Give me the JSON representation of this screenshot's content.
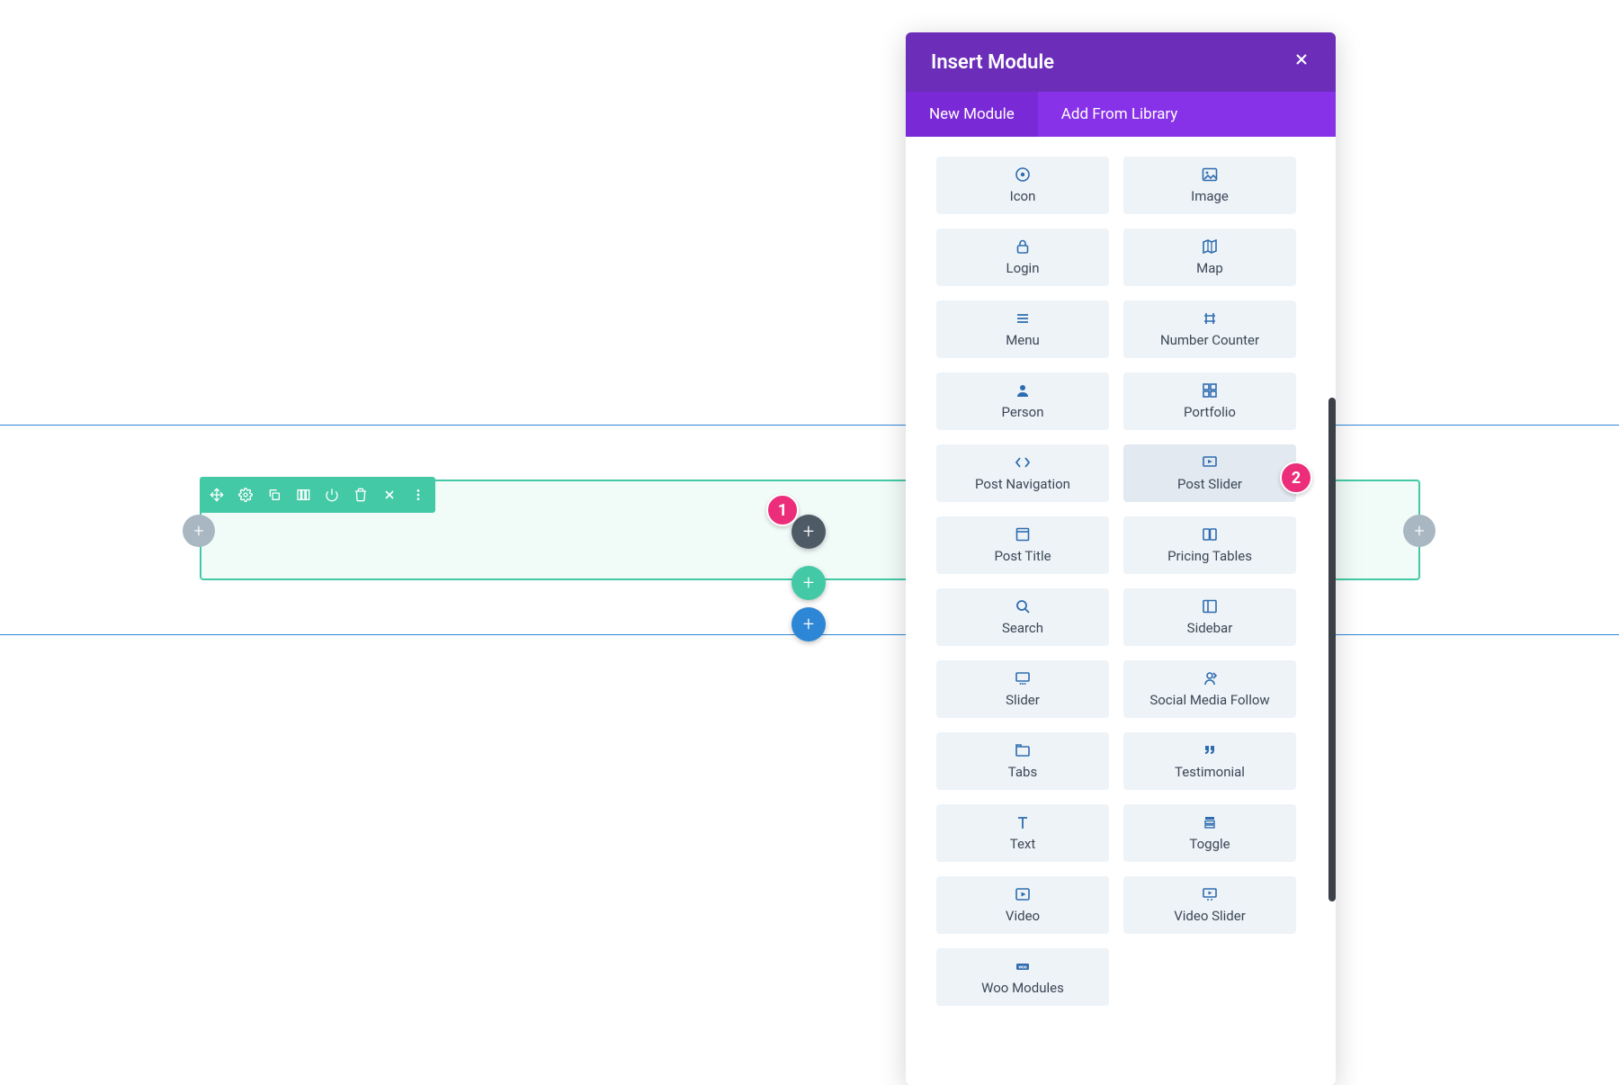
{
  "modal": {
    "title": "Insert Module",
    "close_icon_name": "close-icon",
    "tabs": [
      {
        "label": "New Module",
        "active": true
      },
      {
        "label": "Add From Library",
        "active": false
      }
    ],
    "modules": [
      {
        "label": "Icon",
        "icon": "target"
      },
      {
        "label": "Image",
        "icon": "image"
      },
      {
        "label": "Login",
        "icon": "lock"
      },
      {
        "label": "Map",
        "icon": "map"
      },
      {
        "label": "Menu",
        "icon": "menu"
      },
      {
        "label": "Number Counter",
        "icon": "hash"
      },
      {
        "label": "Person",
        "icon": "person"
      },
      {
        "label": "Portfolio",
        "icon": "grid"
      },
      {
        "label": "Post Navigation",
        "icon": "code"
      },
      {
        "label": "Post Slider",
        "icon": "slideshow",
        "hover": true
      },
      {
        "label": "Post Title",
        "icon": "title"
      },
      {
        "label": "Pricing Tables",
        "icon": "pricing"
      },
      {
        "label": "Search",
        "icon": "search"
      },
      {
        "label": "Sidebar",
        "icon": "sidebar"
      },
      {
        "label": "Slider",
        "icon": "slider"
      },
      {
        "label": "Social Media Follow",
        "icon": "social"
      },
      {
        "label": "Tabs",
        "icon": "tabs"
      },
      {
        "label": "Testimonial",
        "icon": "quote"
      },
      {
        "label": "Text",
        "icon": "text"
      },
      {
        "label": "Toggle",
        "icon": "toggle"
      },
      {
        "label": "Video",
        "icon": "video"
      },
      {
        "label": "Video Slider",
        "icon": "videoslider"
      },
      {
        "label": "Woo Modules",
        "icon": "woo"
      }
    ]
  },
  "annotations": {
    "badge1": "1",
    "badge2": "2"
  },
  "colors": {
    "purple_dark": "#6C2EB9",
    "purple_light": "#8731E8",
    "teal": "#43C9A6",
    "blue": "#2E86D6",
    "pink": "#EC2D7A",
    "card_bg": "#EEF3F7",
    "icon_blue": "#2E6CB0"
  }
}
